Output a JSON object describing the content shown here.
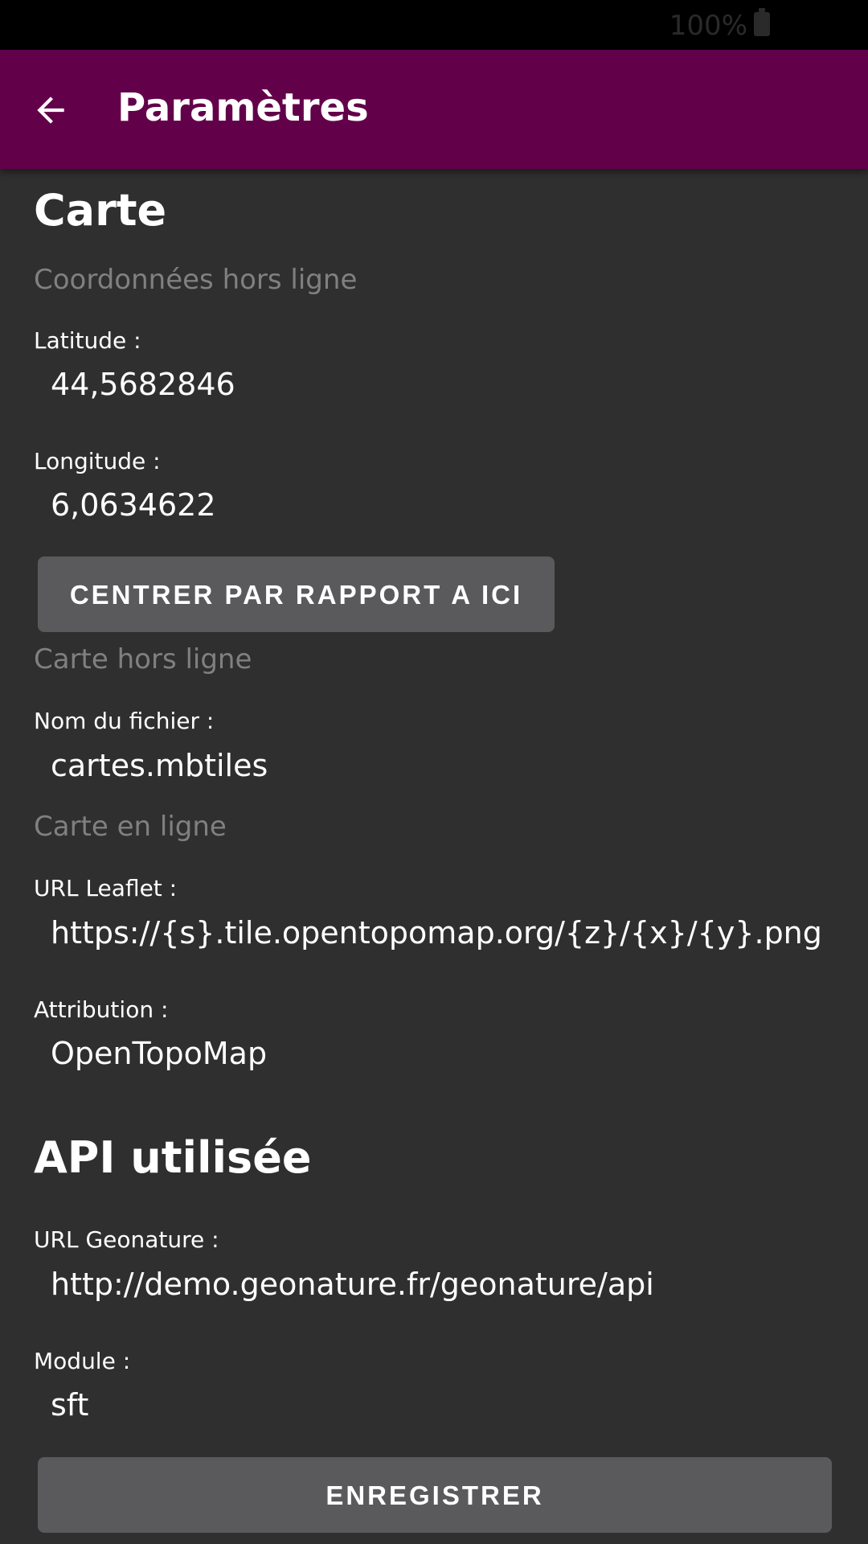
{
  "status_bar": {
    "battery_percent": "100%",
    "battery_icon": "battery-full-icon"
  },
  "app_bar": {
    "back_icon": "arrow-back-icon",
    "title": "Paramètres",
    "color": "#63004a"
  },
  "map_section": {
    "heading": "Carte",
    "offline_coords": {
      "subheading": "Coordonnées hors ligne",
      "latitude_label": "Latitude :",
      "latitude_value": "44,5682846",
      "longitude_label": "Longitude :",
      "longitude_value": "6,0634622",
      "center_button": "CENTRER PAR RAPPORT A ICI"
    },
    "offline_map": {
      "subheading": "Carte hors ligne",
      "filename_label": "Nom du fichier :",
      "filename_value": "cartes.mbtiles"
    },
    "online_map": {
      "subheading": "Carte en ligne",
      "url_label": "URL Leaflet :",
      "url_value": "https://{s}.tile.opentopomap.org/{z}/{x}/{y}.png",
      "attribution_label": "Attribution :",
      "attribution_value": "OpenTopoMap"
    }
  },
  "api_section": {
    "heading": "API utilisée",
    "geonature_label": "URL Geonature :",
    "geonature_value": "http://demo.geonature.fr/geonature/api",
    "module_label": "Module :",
    "module_value": "sft"
  },
  "save_button": "ENREGISTRER",
  "colors": {
    "background": "#2f2f2f",
    "button": "#5a595c",
    "subheading": "#808080"
  }
}
